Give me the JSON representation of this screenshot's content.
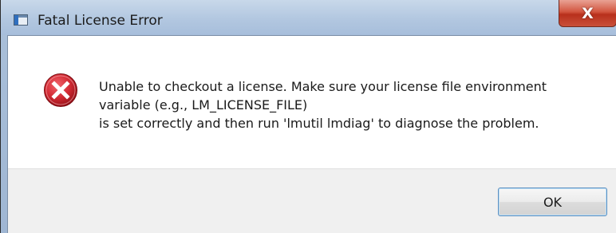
{
  "window": {
    "title": "Fatal License Error",
    "close_label": "X"
  },
  "dialog": {
    "icon": "error-circle-icon",
    "message_lines": [
      "Unable to checkout a license. Make sure your license file environment",
      "variable (e.g., LM_LICENSE_FILE)",
      "is set correctly and then run 'lmutil lmdiag' to diagnose the problem."
    ],
    "ok_label": "OK"
  },
  "colors": {
    "error_red": "#c8202a",
    "titlebar": "#b2c7e0",
    "button_area": "#f0f0f0",
    "close_red": "#c9503a"
  }
}
